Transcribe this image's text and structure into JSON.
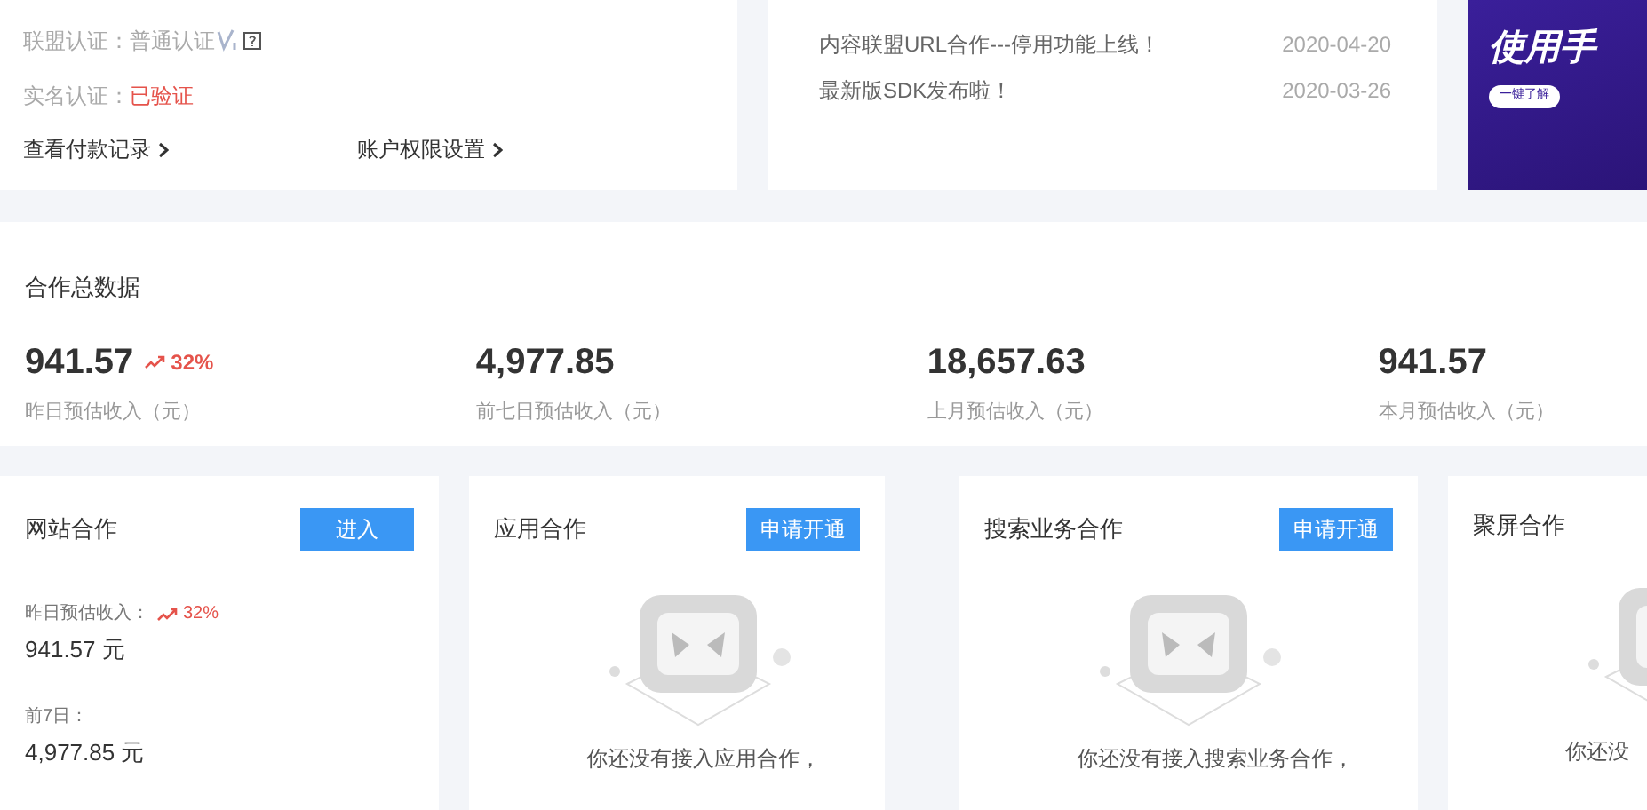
{
  "account": {
    "rows": [
      {
        "label": "联盟认证：",
        "value": "普通认证",
        "kind": "level"
      },
      {
        "label": "实名认证：",
        "value": "已验证",
        "kind": "verified"
      }
    ],
    "links": [
      "查看付款记录",
      "账户权限设置"
    ]
  },
  "news": [
    {
      "title": "内容联盟URL合作---停用功能上线！",
      "date": "2020-04-20"
    },
    {
      "title": "最新版SDK发布啦！",
      "date": "2020-03-26"
    }
  ],
  "banner": {
    "title": "使用手",
    "button": "一键了解"
  },
  "summary": {
    "title": "合作总数据",
    "stats": [
      {
        "value": "941.57",
        "trend": "32%",
        "label": "昨日预估收入（元）"
      },
      {
        "value": "4,977.85",
        "label": "前七日预估收入（元）"
      },
      {
        "value": "18,657.63",
        "label": "上月预估收入（元）"
      },
      {
        "value": "941.57",
        "label": "本月预估收入（元）"
      }
    ]
  },
  "cards": [
    {
      "kind": "active",
      "title": "网站合作",
      "button": "进入",
      "metrics": [
        {
          "label": "昨日预估收入：",
          "trend": "32%",
          "value": "941.57 元"
        },
        {
          "label": "前7日：",
          "value": "4,977.85 元"
        }
      ]
    },
    {
      "kind": "empty",
      "title": "应用合作",
      "button": "申请开通",
      "message": "你还没有接入应用合作，"
    },
    {
      "kind": "empty",
      "title": "搜索业务合作",
      "button": "申请开通",
      "message": "你还没有接入搜索业务合作，"
    },
    {
      "kind": "empty",
      "title": "聚屏合作",
      "message": "你还没"
    }
  ]
}
